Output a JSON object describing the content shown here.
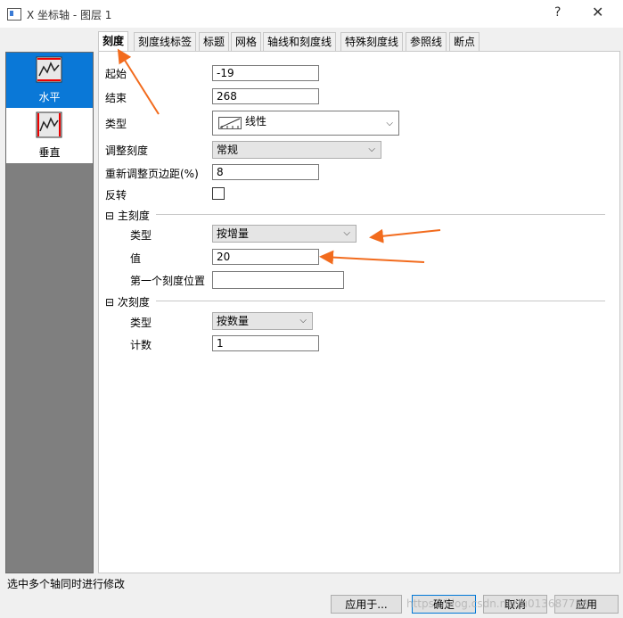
{
  "window": {
    "title": "X 坐标轴 - 图层 1",
    "help_glyph": "?",
    "close_glyph": "✕"
  },
  "left_panel": {
    "items": [
      {
        "label": "水平",
        "icon": "horizontal-axis-icon",
        "selected": true
      },
      {
        "label": "垂直",
        "icon": "vertical-axis-icon",
        "selected": false
      }
    ]
  },
  "tabs": [
    "刻度",
    "刻度线标签",
    "标题",
    "网格",
    "轴线和刻度线",
    "特殊刻度线",
    "参照线",
    "断点"
  ],
  "active_tab": "刻度",
  "form": {
    "start_label": "起始",
    "start_value": "-19",
    "end_label": "结束",
    "end_value": "268",
    "type_label": "类型",
    "type_value": "线性",
    "rescale_label": "调整刻度",
    "rescale_value": "常规",
    "margin_label": "重新调整页边距(%)",
    "margin_value": "8",
    "reverse_label": "反转"
  },
  "major_ticks": {
    "section_label": "主刻度",
    "collapse_glyph": "⊟",
    "type_label": "类型",
    "type_value": "按增量",
    "value_label": "值",
    "value_value": "20",
    "first_tick_label": "第一个刻度位置",
    "first_tick_value": ""
  },
  "minor_ticks": {
    "section_label": "次刻度",
    "collapse_glyph": "⊟",
    "type_label": "类型",
    "type_value": "按数量",
    "count_label": "计数",
    "count_value": "1"
  },
  "status_text": "选中多个轴同时进行修改",
  "buttons": {
    "apply_to": "应用于...",
    "ok": "确定",
    "cancel": "取消",
    "apply": "应用"
  },
  "watermark": "https://blog.csdn.net/u013687759",
  "colors": {
    "accent": "#0a78d7",
    "annotation_arrow": "#f26b1d"
  }
}
